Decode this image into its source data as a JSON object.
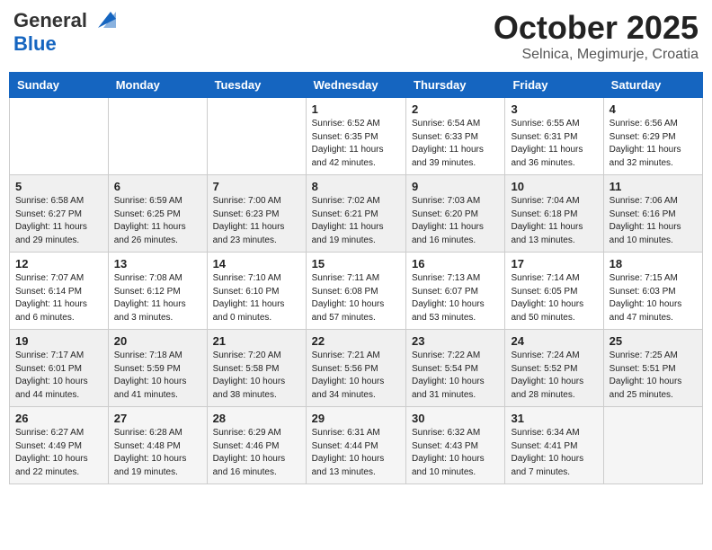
{
  "header": {
    "logo_general": "General",
    "logo_blue": "Blue",
    "month_title": "October 2025",
    "location": "Selnica, Megimurje, Croatia"
  },
  "days_of_week": [
    "Sunday",
    "Monday",
    "Tuesday",
    "Wednesday",
    "Thursday",
    "Friday",
    "Saturday"
  ],
  "weeks": [
    {
      "days": [
        {
          "number": "",
          "info": ""
        },
        {
          "number": "",
          "info": ""
        },
        {
          "number": "",
          "info": ""
        },
        {
          "number": "1",
          "info": "Sunrise: 6:52 AM\nSunset: 6:35 PM\nDaylight: 11 hours and 42 minutes."
        },
        {
          "number": "2",
          "info": "Sunrise: 6:54 AM\nSunset: 6:33 PM\nDaylight: 11 hours and 39 minutes."
        },
        {
          "number": "3",
          "info": "Sunrise: 6:55 AM\nSunset: 6:31 PM\nDaylight: 11 hours and 36 minutes."
        },
        {
          "number": "4",
          "info": "Sunrise: 6:56 AM\nSunset: 6:29 PM\nDaylight: 11 hours and 32 minutes."
        }
      ]
    },
    {
      "days": [
        {
          "number": "5",
          "info": "Sunrise: 6:58 AM\nSunset: 6:27 PM\nDaylight: 11 hours and 29 minutes."
        },
        {
          "number": "6",
          "info": "Sunrise: 6:59 AM\nSunset: 6:25 PM\nDaylight: 11 hours and 26 minutes."
        },
        {
          "number": "7",
          "info": "Sunrise: 7:00 AM\nSunset: 6:23 PM\nDaylight: 11 hours and 23 minutes."
        },
        {
          "number": "8",
          "info": "Sunrise: 7:02 AM\nSunset: 6:21 PM\nDaylight: 11 hours and 19 minutes."
        },
        {
          "number": "9",
          "info": "Sunrise: 7:03 AM\nSunset: 6:20 PM\nDaylight: 11 hours and 16 minutes."
        },
        {
          "number": "10",
          "info": "Sunrise: 7:04 AM\nSunset: 6:18 PM\nDaylight: 11 hours and 13 minutes."
        },
        {
          "number": "11",
          "info": "Sunrise: 7:06 AM\nSunset: 6:16 PM\nDaylight: 11 hours and 10 minutes."
        }
      ]
    },
    {
      "days": [
        {
          "number": "12",
          "info": "Sunrise: 7:07 AM\nSunset: 6:14 PM\nDaylight: 11 hours and 6 minutes."
        },
        {
          "number": "13",
          "info": "Sunrise: 7:08 AM\nSunset: 6:12 PM\nDaylight: 11 hours and 3 minutes."
        },
        {
          "number": "14",
          "info": "Sunrise: 7:10 AM\nSunset: 6:10 PM\nDaylight: 11 hours and 0 minutes."
        },
        {
          "number": "15",
          "info": "Sunrise: 7:11 AM\nSunset: 6:08 PM\nDaylight: 10 hours and 57 minutes."
        },
        {
          "number": "16",
          "info": "Sunrise: 7:13 AM\nSunset: 6:07 PM\nDaylight: 10 hours and 53 minutes."
        },
        {
          "number": "17",
          "info": "Sunrise: 7:14 AM\nSunset: 6:05 PM\nDaylight: 10 hours and 50 minutes."
        },
        {
          "number": "18",
          "info": "Sunrise: 7:15 AM\nSunset: 6:03 PM\nDaylight: 10 hours and 47 minutes."
        }
      ]
    },
    {
      "days": [
        {
          "number": "19",
          "info": "Sunrise: 7:17 AM\nSunset: 6:01 PM\nDaylight: 10 hours and 44 minutes."
        },
        {
          "number": "20",
          "info": "Sunrise: 7:18 AM\nSunset: 5:59 PM\nDaylight: 10 hours and 41 minutes."
        },
        {
          "number": "21",
          "info": "Sunrise: 7:20 AM\nSunset: 5:58 PM\nDaylight: 10 hours and 38 minutes."
        },
        {
          "number": "22",
          "info": "Sunrise: 7:21 AM\nSunset: 5:56 PM\nDaylight: 10 hours and 34 minutes."
        },
        {
          "number": "23",
          "info": "Sunrise: 7:22 AM\nSunset: 5:54 PM\nDaylight: 10 hours and 31 minutes."
        },
        {
          "number": "24",
          "info": "Sunrise: 7:24 AM\nSunset: 5:52 PM\nDaylight: 10 hours and 28 minutes."
        },
        {
          "number": "25",
          "info": "Sunrise: 7:25 AM\nSunset: 5:51 PM\nDaylight: 10 hours and 25 minutes."
        }
      ]
    },
    {
      "days": [
        {
          "number": "26",
          "info": "Sunrise: 6:27 AM\nSunset: 4:49 PM\nDaylight: 10 hours and 22 minutes."
        },
        {
          "number": "27",
          "info": "Sunrise: 6:28 AM\nSunset: 4:48 PM\nDaylight: 10 hours and 19 minutes."
        },
        {
          "number": "28",
          "info": "Sunrise: 6:29 AM\nSunset: 4:46 PM\nDaylight: 10 hours and 16 minutes."
        },
        {
          "number": "29",
          "info": "Sunrise: 6:31 AM\nSunset: 4:44 PM\nDaylight: 10 hours and 13 minutes."
        },
        {
          "number": "30",
          "info": "Sunrise: 6:32 AM\nSunset: 4:43 PM\nDaylight: 10 hours and 10 minutes."
        },
        {
          "number": "31",
          "info": "Sunrise: 6:34 AM\nSunset: 4:41 PM\nDaylight: 10 hours and 7 minutes."
        },
        {
          "number": "",
          "info": ""
        }
      ]
    }
  ]
}
